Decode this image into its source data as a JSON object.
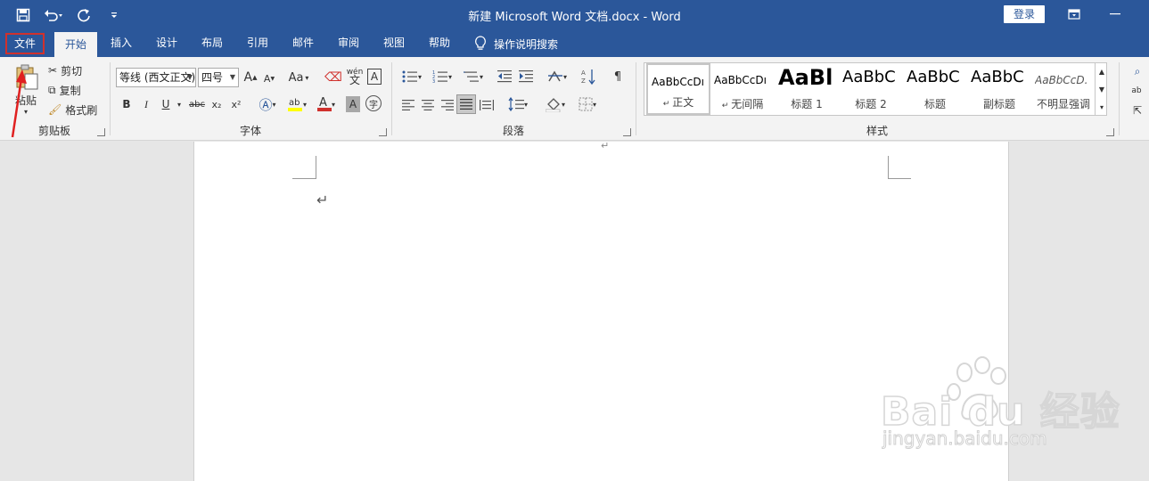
{
  "titlebar": {
    "title": "新建 Microsoft Word 文档.docx  -  Word",
    "login_label": "登录",
    "qat_icons": [
      "save-icon",
      "undo-icon",
      "redo-icon",
      "customize-qat-icon"
    ],
    "accent": "#2b579a"
  },
  "tabs": [
    {
      "label": "文件"
    },
    {
      "label": "开始"
    },
    {
      "label": "插入"
    },
    {
      "label": "设计"
    },
    {
      "label": "布局"
    },
    {
      "label": "引用"
    },
    {
      "label": "邮件"
    },
    {
      "label": "审阅"
    },
    {
      "label": "视图"
    },
    {
      "label": "帮助"
    }
  ],
  "tell_me": "操作说明搜索",
  "clipboard": {
    "paste": "粘贴",
    "cut": "剪切",
    "copy": "复制",
    "format_painter": "格式刷",
    "group_label": "剪贴板"
  },
  "font": {
    "font_name": "等线 (西文正文)",
    "font_size": "四号",
    "grow": "A",
    "shrink": "A",
    "case": "Aa",
    "bold": "B",
    "italic": "I",
    "underline": "U",
    "strike": "abc",
    "subscript": "x₂",
    "superscript": "x²",
    "pinyin": "wén",
    "group_label": "字体",
    "highlight_color": "#ffff00",
    "font_color": "#d0312d"
  },
  "paragraph": {
    "group_label": "段落"
  },
  "styles": {
    "group_label": "样式",
    "items": [
      {
        "preview": "AaBbCcDı",
        "name": "正文"
      },
      {
        "preview": "AaBbCcDı",
        "name": "无间隔"
      },
      {
        "preview": "AaBl",
        "name": "标题 1"
      },
      {
        "preview": "AaBbC",
        "name": "标题 2"
      },
      {
        "preview": "AaBbC",
        "name": "标题"
      },
      {
        "preview": "AaBbC",
        "name": "副标题"
      },
      {
        "preview": "AaBbCcD.",
        "name": "不明显强调"
      }
    ]
  },
  "watermark": {
    "brand": "Bai du 经验",
    "url": "jingyan.baidu.com"
  }
}
